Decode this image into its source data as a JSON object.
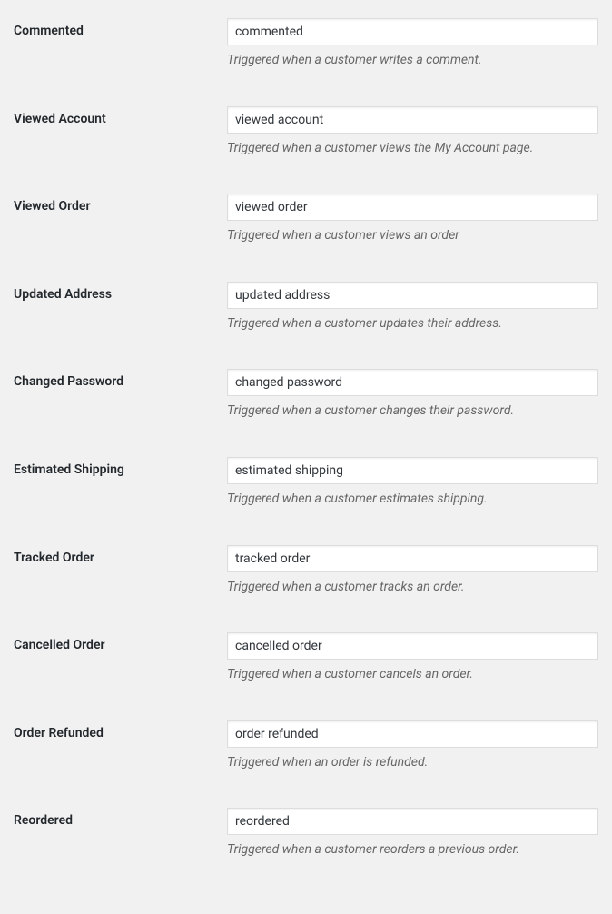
{
  "events": [
    {
      "label": "Commented",
      "value": "commented",
      "help": "Triggered when a customer writes a comment."
    },
    {
      "label": "Viewed Account",
      "value": "viewed account",
      "help": "Triggered when a customer views the My Account page."
    },
    {
      "label": "Viewed Order",
      "value": "viewed order",
      "help": "Triggered when a customer views an order"
    },
    {
      "label": "Updated Address",
      "value": "updated address",
      "help": "Triggered when a customer updates their address."
    },
    {
      "label": "Changed Password",
      "value": "changed password",
      "help": "Triggered when a customer changes their password."
    },
    {
      "label": "Estimated Shipping",
      "value": "estimated shipping",
      "help": "Triggered when a customer estimates shipping."
    },
    {
      "label": "Tracked Order",
      "value": "tracked order",
      "help": "Triggered when a customer tracks an order."
    },
    {
      "label": "Cancelled Order",
      "value": "cancelled order",
      "help": "Triggered when a customer cancels an order."
    },
    {
      "label": "Order Refunded",
      "value": "order refunded",
      "help": "Triggered when an order is refunded."
    },
    {
      "label": "Reordered",
      "value": "reordered",
      "help": "Triggered when a customer reorders a previous order."
    }
  ]
}
